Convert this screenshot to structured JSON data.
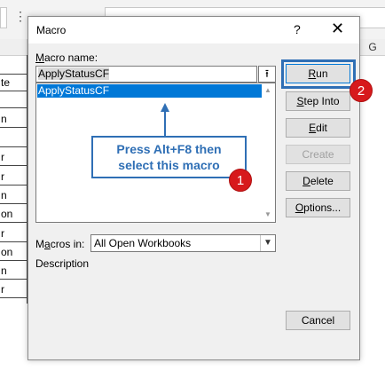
{
  "sheet": {
    "column_letter": "G",
    "cells": [
      "te",
      "",
      "n",
      "",
      "r",
      "r",
      "n",
      "on",
      "r",
      "on",
      "n",
      "r"
    ]
  },
  "dialog": {
    "title": "Macro",
    "help_glyph": "?",
    "close_glyph": "✕",
    "macro_name_label_u": "M",
    "macro_name_label_rest": "acro name:",
    "macro_name_value": "ApplyStatusCF",
    "upload_glyph": "⭱",
    "macro_list": [
      "ApplyStatusCF"
    ],
    "macros_in_label_pre": "M",
    "macros_in_label_u": "a",
    "macros_in_label_rest": "cros in:",
    "macros_in_value": "All Open Workbooks",
    "description_label": "Description",
    "buttons": {
      "run": {
        "u": "R",
        "rest": "un"
      },
      "step_into": {
        "u": "S",
        "rest": "tep Into"
      },
      "edit": {
        "u": "E",
        "rest": "dit"
      },
      "create": {
        "label": "Create"
      },
      "delete": {
        "u": "D",
        "rest": "elete"
      },
      "options": {
        "u": "O",
        "rest": "ptions..."
      },
      "cancel": {
        "label": "Cancel"
      }
    }
  },
  "annotations": {
    "callout_line1": "Press Alt+F8 then",
    "callout_line2": "select this macro",
    "badge1": "1",
    "badge2": "2",
    "accent_color": "#2f6fb5",
    "badge_color": "#d7191c"
  }
}
